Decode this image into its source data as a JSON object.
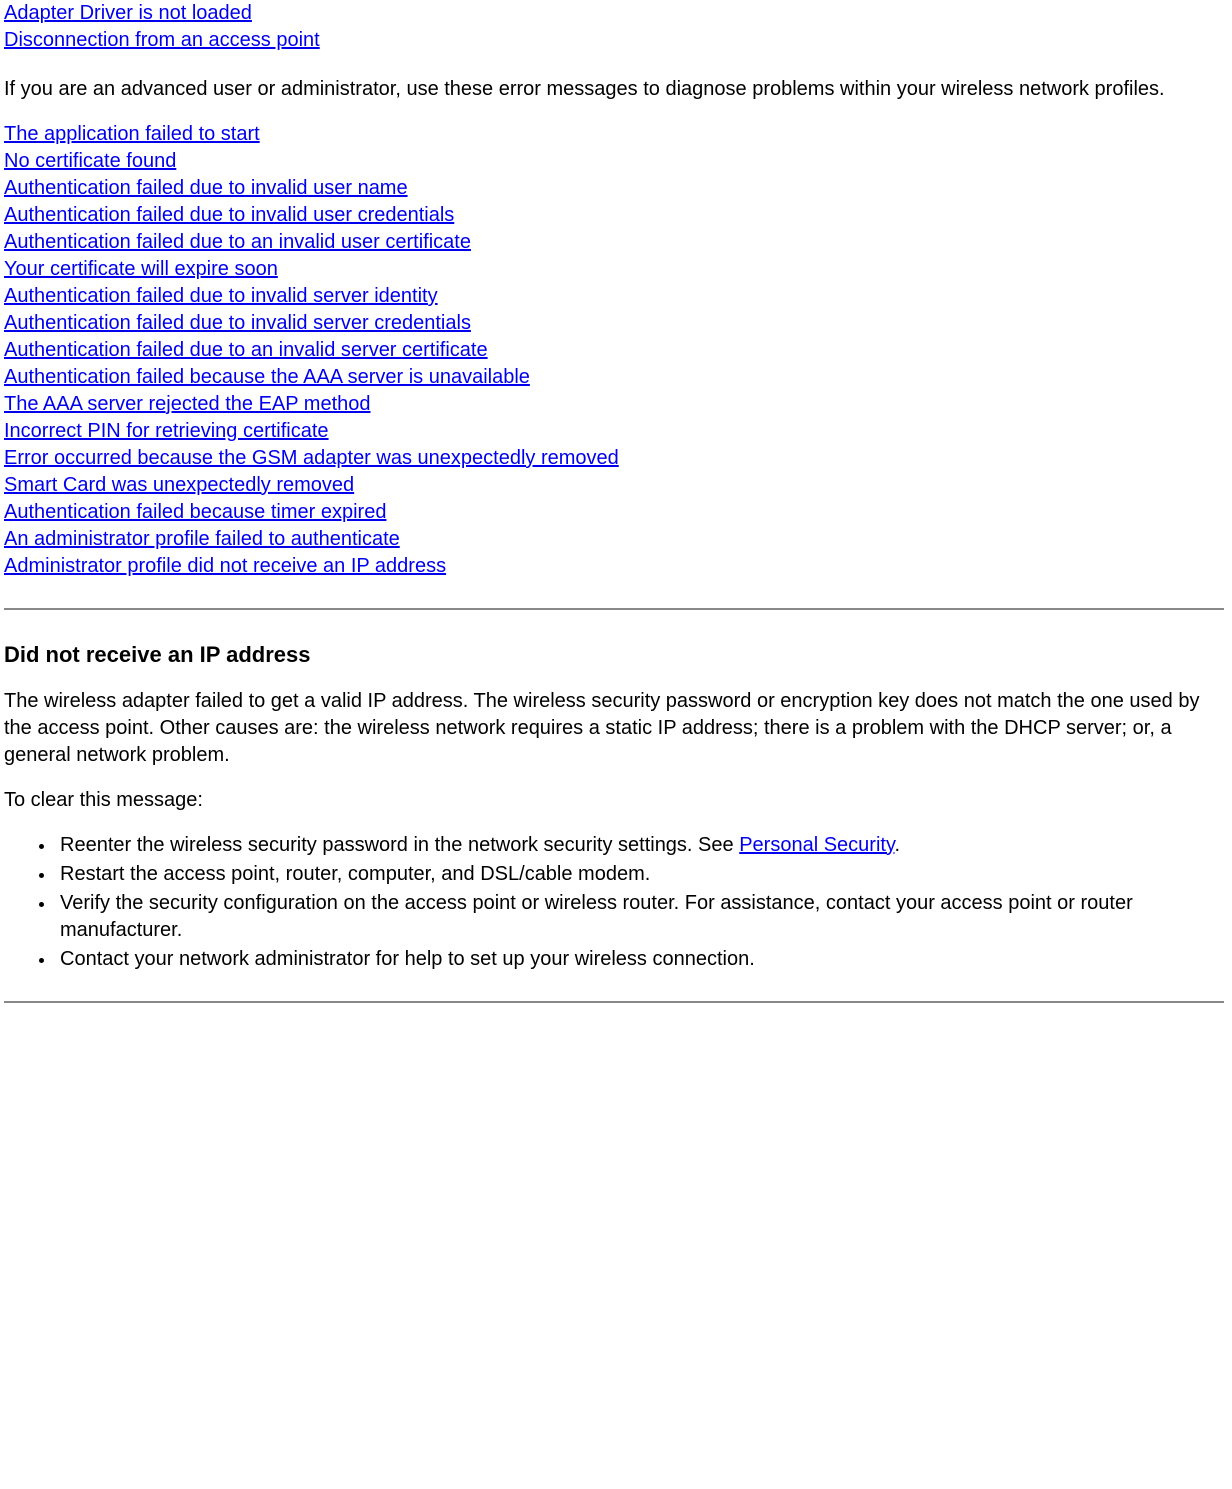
{
  "top_links": [
    "Adapter Driver is not loaded",
    "Disconnection from an access point"
  ],
  "intro_paragraph": "If you are an advanced user or administrator, use these error messages to diagnose problems within your wireless network profiles.",
  "error_links": [
    "The application failed to start",
    "No certificate found",
    "Authentication failed due to invalid user name",
    "Authentication failed due to invalid user credentials",
    "Authentication failed due to an invalid user certificate",
    "Your certificate will expire soon",
    "Authentication failed due to invalid server identity",
    "Authentication failed due to invalid server credentials",
    "Authentication failed due to an invalid server certificate",
    "Authentication failed because the AAA server is unavailable",
    "The AAA server rejected the EAP method",
    "Incorrect PIN for retrieving certificate",
    "Error occurred because the GSM adapter was unexpectedly removed",
    "Smart Card was unexpectedly removed",
    "Authentication failed because timer expired",
    "An administrator profile failed to authenticate",
    "Administrator profile did not receive an IP address"
  ],
  "section": {
    "heading": "Did not receive an IP address",
    "paragraph": "The wireless adapter failed to get a valid IP address. The wireless security password or encryption key does not match the one used by the access point. Other causes are: the wireless network requires a static IP address; there is a problem with the DHCP server; or, a general network problem.",
    "lead_in": "To clear this message:",
    "bullets": {
      "b1_pre": "Reenter the wireless security password in the network security settings. See ",
      "b1_link": "Personal Security",
      "b1_post": ".",
      "b2": "Restart the access point, router, computer, and DSL/cable modem.",
      "b3": "Verify the security configuration on the access point or wireless router. For assistance, contact your access point or router manufacturer.",
      "b4": "Contact your network administrator for help to set up your wireless connection."
    }
  }
}
